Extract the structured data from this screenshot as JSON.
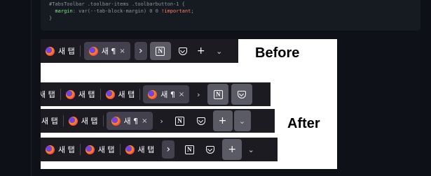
{
  "code": {
    "line1": "#TabsToolbar .toolbar-items .toolbarbutton-1 {",
    "line2_prop": "margin",
    "line2_value": ": var(--tab-block-margin) 0 0 ",
    "line2_important": "!important",
    "line2_end": ";",
    "line3": "}"
  },
  "labels": {
    "before": "Before",
    "after": "After"
  },
  "tab_title": "새 탭",
  "tab_title_cut": "새 탭",
  "selected_tab_title": "새 ¶",
  "close_glyph": "×",
  "notion_letter": "N",
  "icons": {
    "chevron_right": "›",
    "plus": "+",
    "chevron_down": "⌄"
  },
  "colors": {
    "toolbar_bg": "#1c1b22",
    "selected_tab": "#42414d",
    "page_bg": "#0e1117"
  }
}
